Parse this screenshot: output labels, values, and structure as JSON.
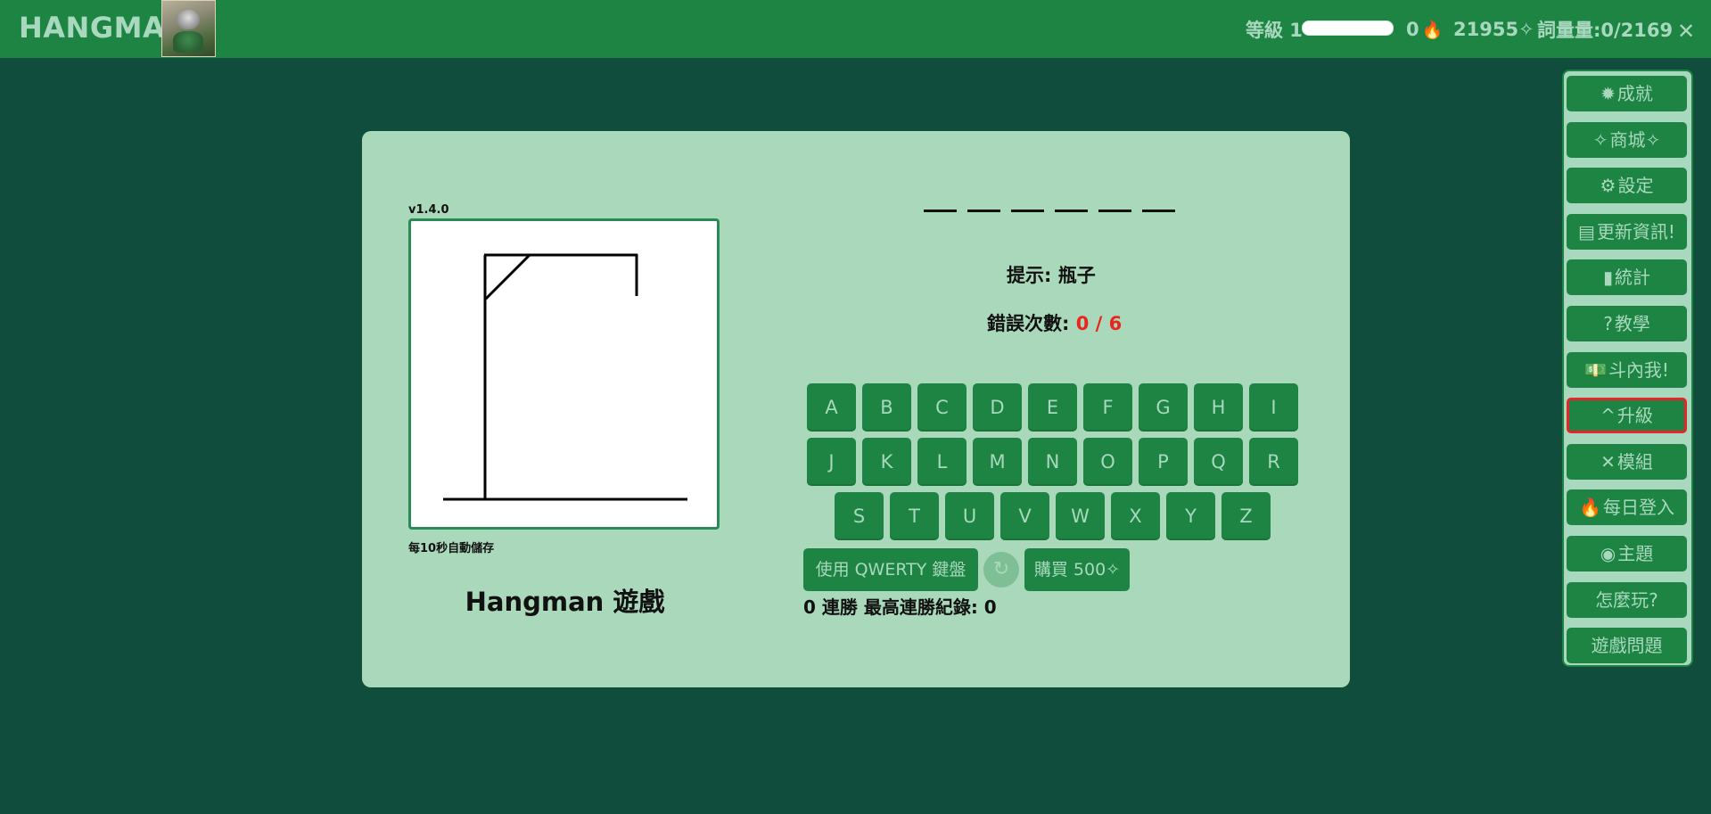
{
  "header": {
    "brand": "HANGMAN",
    "level_label": "等級 1",
    "level_progress": 0,
    "streak": "0",
    "coins": "21955✧",
    "vocab": "詞量量:0/2169",
    "close_label": "✕"
  },
  "game": {
    "version": "v1.4.0",
    "autosave": "每10秒自動儲存",
    "title": "Hangman 遊戲",
    "hint": "提示: 瓶子",
    "mistakes_label": "錯誤次數: ",
    "mistakes_value": "0 / 6",
    "word_length": 6,
    "keys_row1": [
      "A",
      "B",
      "C",
      "D",
      "E",
      "F",
      "G",
      "H",
      "I"
    ],
    "keys_row2": [
      "J",
      "K",
      "L",
      "M",
      "N",
      "O",
      "P",
      "Q",
      "R"
    ],
    "keys_row3": [
      "S",
      "T",
      "U",
      "V",
      "W",
      "X",
      "Y",
      "Z"
    ],
    "qwerty_label": "使用 QWERTY 鍵盤",
    "buy_label": "購買 500✧",
    "streak_record": "0 連勝 最高連勝紀錄: 0"
  },
  "menu": [
    {
      "icon": "✹",
      "icon_name": "badge-icon",
      "label": "成就"
    },
    {
      "icon": "✧",
      "icon_name": "sparkle-icon",
      "label": "商城✧"
    },
    {
      "icon": "⚙",
      "icon_name": "gear-icon",
      "label": "設定"
    },
    {
      "icon": "▤",
      "icon_name": "newspaper-icon",
      "label": "更新資訊!"
    },
    {
      "icon": "▮",
      "icon_name": "bar-chart-icon",
      "label": "統計"
    },
    {
      "icon": "?",
      "icon_name": "question-icon",
      "label": "教學"
    },
    {
      "icon": "💵",
      "icon_name": "money-icon",
      "label": "斗內我!"
    },
    {
      "icon": "^",
      "icon_name": "caret-up-icon",
      "label": "升級"
    },
    {
      "icon": "✕",
      "icon_name": "tools-icon",
      "label": "模組"
    },
    {
      "icon": "🔥",
      "icon_name": "fire-icon",
      "label": "每日登入"
    },
    {
      "icon": "◉",
      "icon_name": "palette-icon",
      "label": "主題"
    },
    {
      "icon": "",
      "icon_name": "",
      "label": "怎麼玩?"
    },
    {
      "icon": "",
      "icon_name": "",
      "label": "遊戲問題"
    }
  ]
}
